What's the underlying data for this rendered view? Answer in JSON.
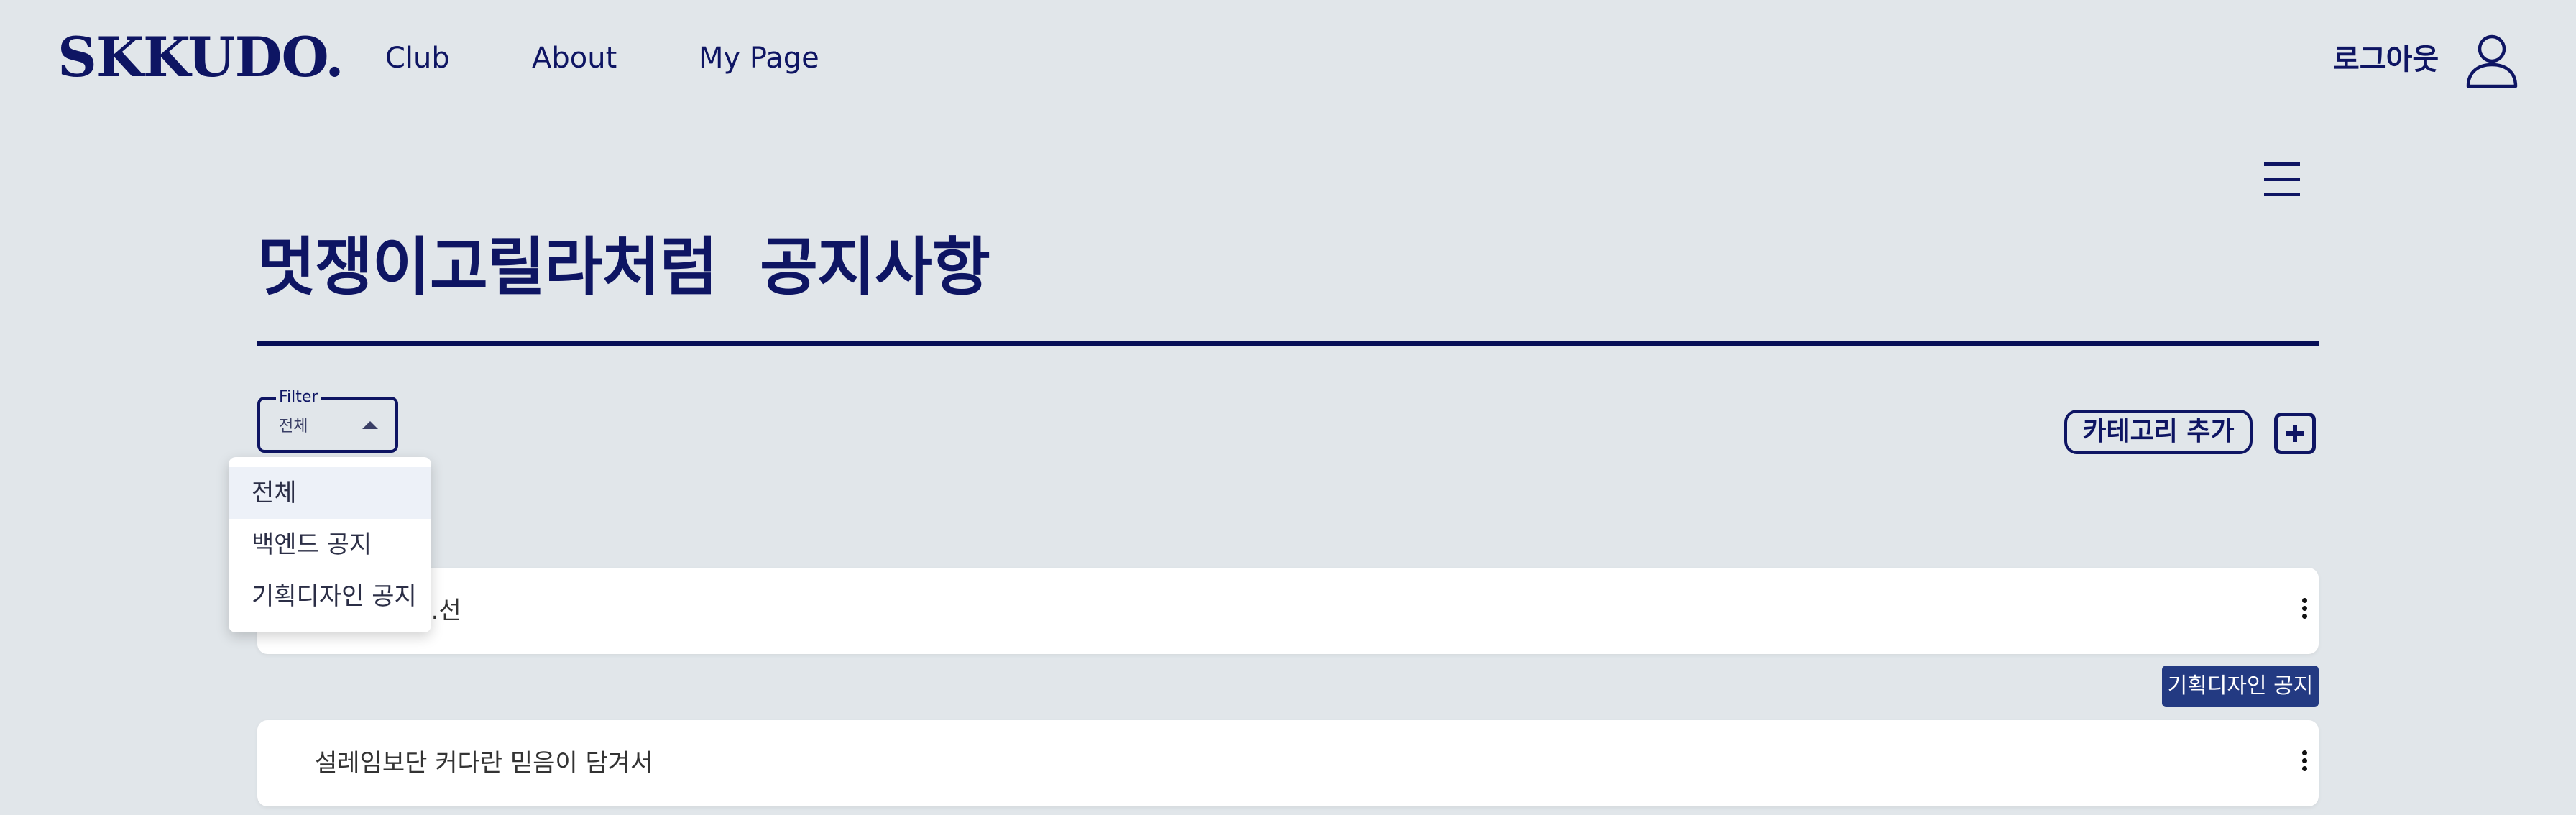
{
  "header": {
    "logo": "SKKUDO.",
    "nav": [
      "Club",
      "About",
      "My Page"
    ],
    "logout_label": "로그아웃"
  },
  "page": {
    "title": "멋쟁이고릴라처럼  공지사항"
  },
  "filter": {
    "legend": "Filter",
    "selected": "전체",
    "options": [
      "전체",
      "백엔드 공지",
      "기획디자인 공지"
    ]
  },
  "category": {
    "add_label": "카테고리 추가"
  },
  "posts": [
    {
      "title": "...선",
      "tag": ""
    },
    {
      "title": "설레임보단 커다란 믿음이 담겨서",
      "tag": "기획디자인 공지"
    }
  ],
  "colors": {
    "background": "#e1e6ea",
    "primary": "#0e1563",
    "tag_bg": "#233a82"
  }
}
